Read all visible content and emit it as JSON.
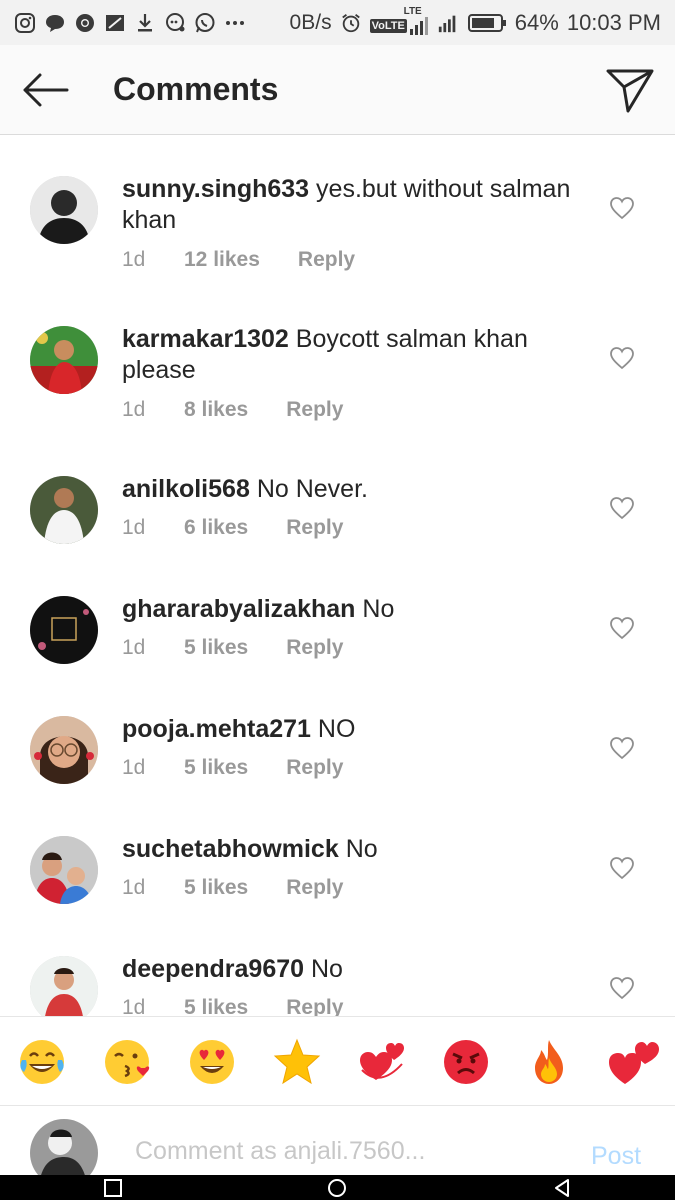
{
  "status_bar": {
    "net_speed": "0B/s",
    "volte_label": "VoLTE",
    "lte_label": "LTE",
    "battery_percent": "64%",
    "time": "10:03 PM"
  },
  "header": {
    "title": "Comments"
  },
  "comments": [
    {
      "username": "sunny.singh633",
      "text": "yes.but without salman khan",
      "time": "1d",
      "likes": "12 likes",
      "reply": "Reply"
    },
    {
      "username": "karmakar1302",
      "text": "Boycott salman khan please",
      "time": "1d",
      "likes": "8 likes",
      "reply": "Reply"
    },
    {
      "username": "anilkoli568",
      "text": "No Never.",
      "time": "1d",
      "likes": "6 likes",
      "reply": "Reply"
    },
    {
      "username": "ghararabyalizakhan",
      "text": "No",
      "time": "1d",
      "likes": "5 likes",
      "reply": "Reply"
    },
    {
      "username": "pooja.mehta271",
      "text": "NO",
      "time": "1d",
      "likes": "5 likes",
      "reply": "Reply"
    },
    {
      "username": "suchetabhowmick",
      "text": "No",
      "time": "1d",
      "likes": "5 likes",
      "reply": "Reply"
    },
    {
      "username": "deependra9670",
      "text": "No",
      "time": "1d",
      "likes": "5 likes",
      "reply": "Reply"
    }
  ],
  "emoji_bar": {
    "emojis": [
      "face-with-tears-of-joy",
      "face-blowing-kiss",
      "smiling-face-with-heart-eyes",
      "star",
      "revolving-hearts",
      "angry-face",
      "fire",
      "two-hearts"
    ]
  },
  "composer": {
    "placeholder": "Comment as anjali.7560...",
    "post_label": "Post"
  },
  "colors": {
    "text": "#262626",
    "meta": "#999999",
    "post_disabled": "#b3dbff",
    "divider": "#dbdbdb"
  }
}
